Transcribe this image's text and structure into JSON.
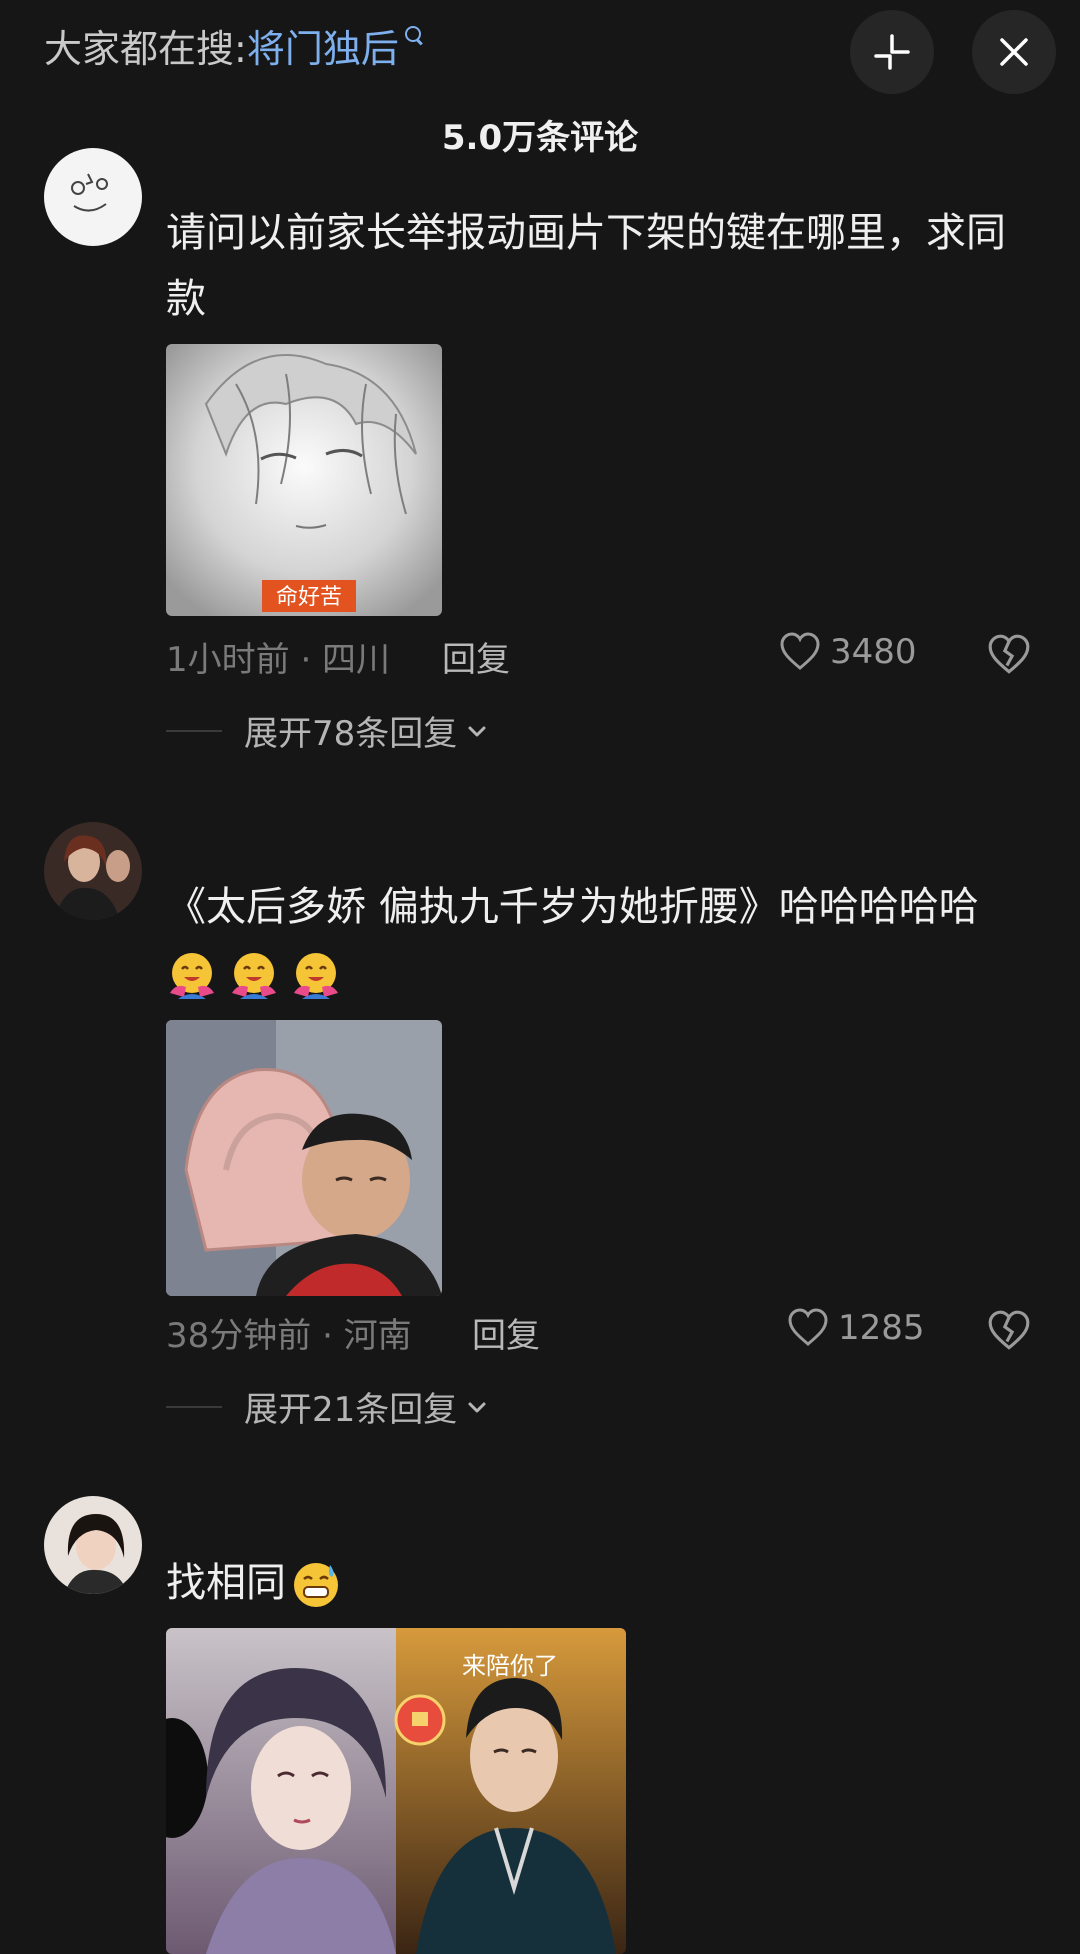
{
  "header": {
    "search_prefix": "大家都在搜:",
    "search_keyword": "将门独后",
    "comment_count": "5.0万条评论"
  },
  "comments": [
    {
      "text": "请问以前家长举报动画片下架的键在哪里，求同款",
      "image_caption": "命好苦",
      "time_location": "1小时前 · 四川",
      "reply_label": "回复",
      "likes": "3480",
      "expand_label": "展开78条回复"
    },
    {
      "text": "《太后多娇 偏执九千岁为她折腰》哈哈哈哈哈",
      "time_location": "38分钟前 · 河南",
      "reply_label": "回复",
      "likes": "1285",
      "expand_label": "展开21条回复"
    },
    {
      "text": "找相同",
      "image_caption": "来陪你了"
    }
  ],
  "icons": {
    "collapse": "collapse-icon",
    "close": "close-icon",
    "like": "heart-icon",
    "dislike": "broken-heart-icon",
    "expand": "chevron-down-icon"
  },
  "colors": {
    "background": "#161616",
    "keyword": "#7fb0ee"
  }
}
